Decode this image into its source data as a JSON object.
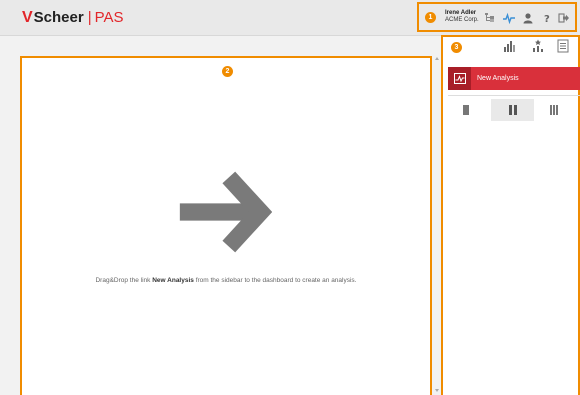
{
  "header": {
    "logo": {
      "mark": "V",
      "brand": "Scheer",
      "separator": "|",
      "product": "PAS"
    },
    "user": {
      "name": "Irene Adler",
      "company": "ACME Corp."
    },
    "icons": [
      "org-tree-icon",
      "activity-icon",
      "user-icon",
      "help-icon",
      "logout-icon"
    ],
    "callout": "1"
  },
  "main": {
    "callout": "2",
    "instruction_pre": "Drag&Drop the link ",
    "instruction_bold": "New Analysis",
    "instruction_post": " from the sidebar to the dashboard to create an analysis."
  },
  "sidebar": {
    "callout": "3",
    "tool_icons": [
      "bar-chart-icon",
      "ranking-chart-icon",
      "document-icon"
    ],
    "new_analysis_label": "New Analysis",
    "layout_options": [
      "one-column",
      "two-columns",
      "three-columns"
    ],
    "selected_layout": "two-columns"
  },
  "colors": {
    "accent": "#f08c00",
    "brand_red": "#e2262a",
    "button_red": "#d9303b",
    "header_bg": "#e9e9e9",
    "arrow": "#7a7a7a",
    "activity_icon": "#3a8fd6"
  }
}
